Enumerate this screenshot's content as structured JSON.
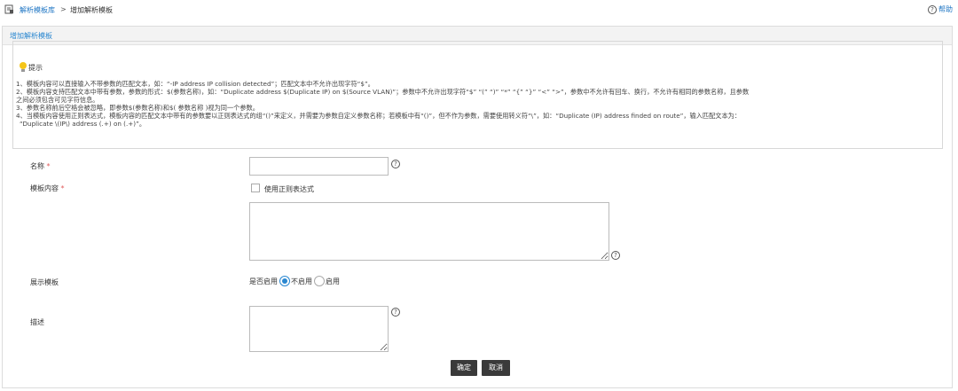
{
  "breadcrumb": {
    "link": "解析模板库",
    "separator": ">",
    "current": "增加解析模板"
  },
  "help_label": "帮助",
  "panel_title": "增加解析模板",
  "tips": {
    "title": "提示",
    "lines": [
      "1、模板内容可以直接输入不带参数的匹配文本，如：“-IP address IP collision detected”；匹配文本中不允许出现字符“$”。",
      "2、模板内容支持匹配文本中带有参数，参数的形式：$(参数名称)，如：“Duplicate address $(Duplicate IP) on $(Source VLAN)”；参数中不允许出现字符“$” “(” “)” “*” “{” “}” “<” “>”，参数中不允许有回车、换行，不允许有相同的参数名称，且参数",
      "之间必须包含可见字符信息。",
      "3、参数名称前后空格会被忽略，即参数$(参数名称)和$( 参数名称 )视为同一个参数。",
      "4、当模板内容使用正则表达式，模板内容的匹配文本中带有的参数要以正则表达式的组“()”来定义，并需要为参数自定义参数名称；若模板中有“()”，但不作为参数，需要使用转义符“\\”，如：“Duplicate (IP) address finded on route”，输入匹配文本为：",
      "“Duplicate \\(IP\\) address (.+) on (.+)”。"
    ]
  },
  "form": {
    "name_label": "名称",
    "name_value": "",
    "content_label": "模板内容",
    "regex_label": "使用正则表达式",
    "regex_checked": false,
    "content_value": "",
    "display_label": "展示模板",
    "enable_question": "是否启用",
    "option_disable": "不启用",
    "option_enable": "启用",
    "selected_option": "不启用",
    "desc_label": "描述",
    "desc_value": "",
    "required_mark": "*"
  },
  "buttons": {
    "confirm": "确定",
    "cancel": "取消"
  },
  "icons": {
    "breadcrumb": "template-library-icon",
    "help": "question-circle-icon",
    "tips": "lightbulb-icon",
    "field_help": "question-circle-icon"
  },
  "colors": {
    "link": "#1f76c4",
    "accent": "#2a87d0",
    "required": "#e05a5a",
    "button": "#3a3a3a"
  }
}
